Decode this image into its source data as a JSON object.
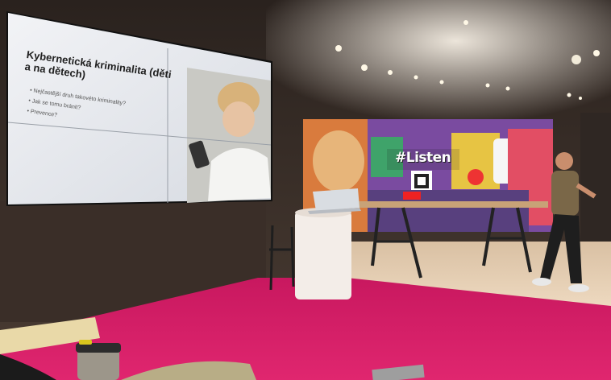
{
  "slide": {
    "title_lines": [
      "Kybernetická kriminalita (děti",
      "a na dětech)"
    ],
    "bullets": [
      "Nejčastější druh takovéto kriminality?",
      "Jak se tomu bránit?",
      "Prevence?"
    ]
  },
  "wall": {
    "text": "#Listen"
  },
  "colors": {
    "carpet": "#d81b6b",
    "wall_dark": "#3b302b",
    "screen": "#e6e8ec",
    "stage_floor": "#e8d2b8"
  }
}
